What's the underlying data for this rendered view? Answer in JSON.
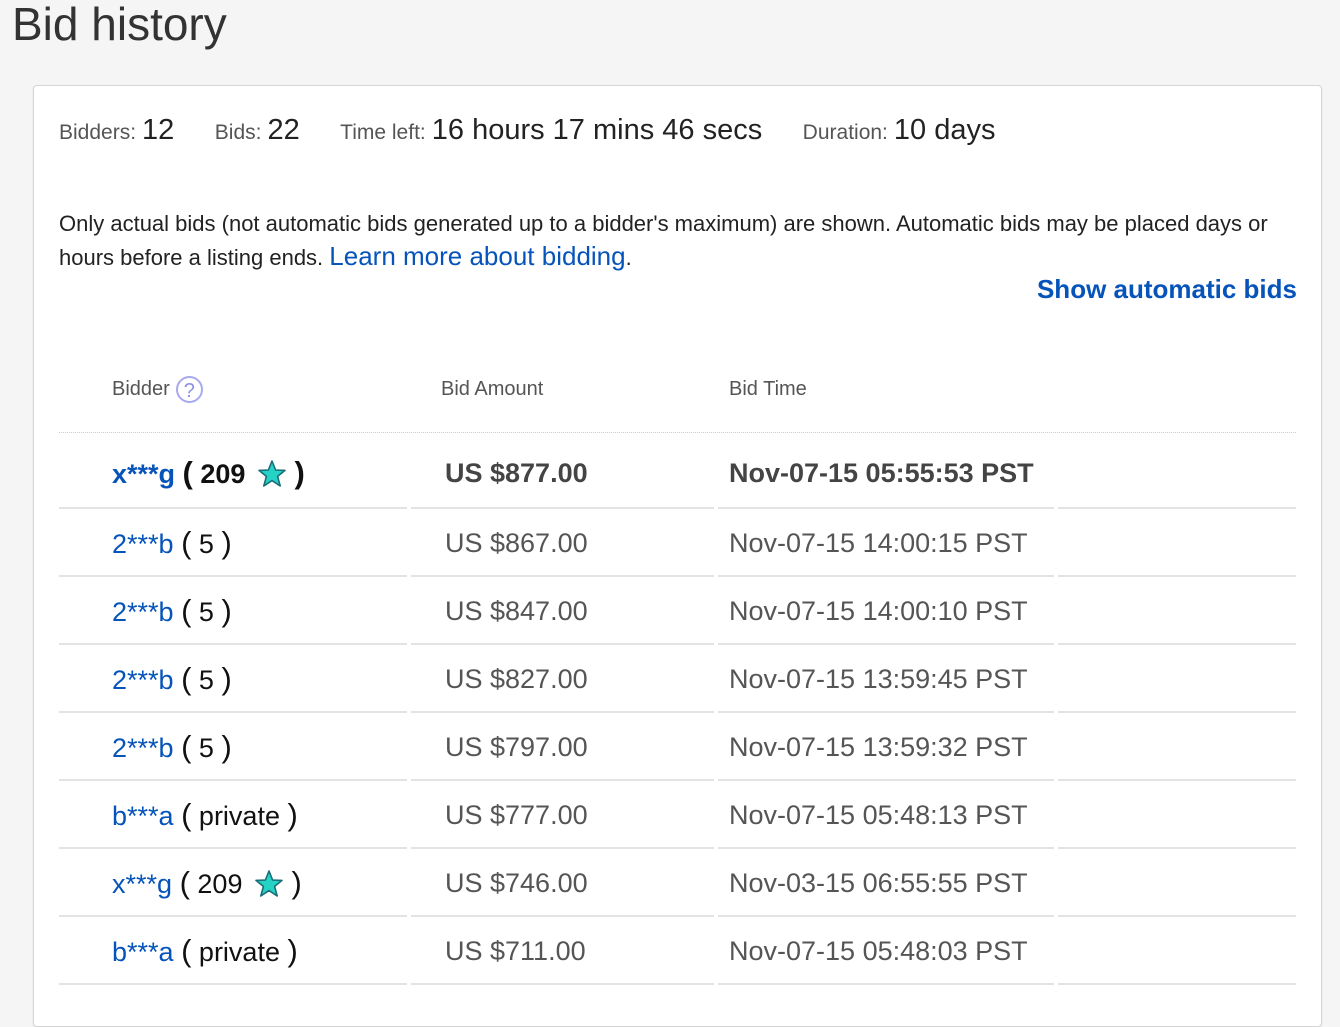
{
  "page": {
    "title": "Bid history"
  },
  "summary": {
    "bidders_label": "Bidders:",
    "bidders_value": "12",
    "bids_label": "Bids:",
    "bids_value": "22",
    "time_left_label": "Time left:",
    "time_left_value": "16 hours 17 mins 46 secs",
    "duration_label": "Duration:",
    "duration_value": "10 days"
  },
  "info": {
    "text": "Only actual bids (not automatic bids generated up to a bidder's maximum) are shown. Automatic bids may be placed days or hours before a listing ends. ",
    "link_label": "Learn more about bidding",
    "trailing": "."
  },
  "show_automatic_label": "Show automatic bids",
  "table": {
    "headers": {
      "bidder": "Bidder",
      "amount": "Bid Amount",
      "time": "Bid Time"
    },
    "help_glyph": "?",
    "rows": [
      {
        "bidder": "x***g",
        "score": "209",
        "star": true,
        "amount": "US $877.00",
        "time": "Nov-07-15 05:55:53 PST"
      },
      {
        "bidder": "2***b",
        "score": "5",
        "star": false,
        "amount": "US $867.00",
        "time": "Nov-07-15 14:00:15 PST"
      },
      {
        "bidder": "2***b",
        "score": "5",
        "star": false,
        "amount": "US $847.00",
        "time": "Nov-07-15 14:00:10 PST"
      },
      {
        "bidder": "2***b",
        "score": "5",
        "star": false,
        "amount": "US $827.00",
        "time": "Nov-07-15 13:59:45 PST"
      },
      {
        "bidder": "2***b",
        "score": "5",
        "star": false,
        "amount": "US $797.00",
        "time": "Nov-07-15 13:59:32 PST"
      },
      {
        "bidder": "b***a",
        "score": "private",
        "star": false,
        "amount": "US $777.00",
        "time": "Nov-07-15 05:48:13 PST"
      },
      {
        "bidder": "x***g",
        "score": "209",
        "star": true,
        "amount": "US $746.00",
        "time": "Nov-03-15 06:55:55 PST"
      },
      {
        "bidder": "b***a",
        "score": "private",
        "star": false,
        "amount": "US $711.00",
        "time": "Nov-07-15 05:48:03 PST"
      }
    ]
  },
  "colors": {
    "link": "#0654ba",
    "star_fill": "#24d3c4",
    "star_stroke": "#1a6d7a"
  },
  "icons": {
    "help": "question-circle-icon",
    "star": "feedback-star-icon"
  }
}
